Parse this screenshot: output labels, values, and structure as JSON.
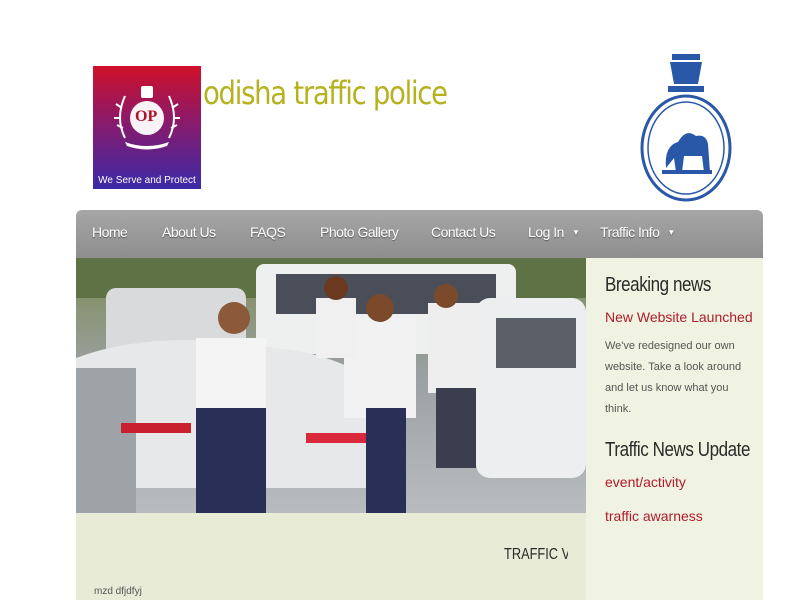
{
  "header": {
    "logo_motto": "We Serve and Protect",
    "logo_monogram": "OP",
    "site_title": "odisha traffic police"
  },
  "nav": {
    "items": [
      {
        "label": "Home"
      },
      {
        "label": "About Us"
      },
      {
        "label": "FAQS"
      },
      {
        "label": "Photo Gallery"
      },
      {
        "label": "Contact Us"
      },
      {
        "label": "Log In"
      },
      {
        "label": "Traffic Info"
      }
    ]
  },
  "sidebar": {
    "breaking_title": "Breaking news",
    "breaking_link": "New Website Launched",
    "breaking_body": "We've redesigned our own website. Take a look around and let us know what you think.",
    "traffic_title": "Traffic News Update",
    "links": [
      "event/activity",
      "traffic awarness"
    ]
  },
  "main": {
    "section_title": "TRAFFIC VIO",
    "footer_note": "mzd dfjdfyj"
  },
  "colors": {
    "title": "#b6b21f",
    "nav": "#999999",
    "link": "#b01c2c",
    "sidebar_bg": "#f0f2e2"
  }
}
